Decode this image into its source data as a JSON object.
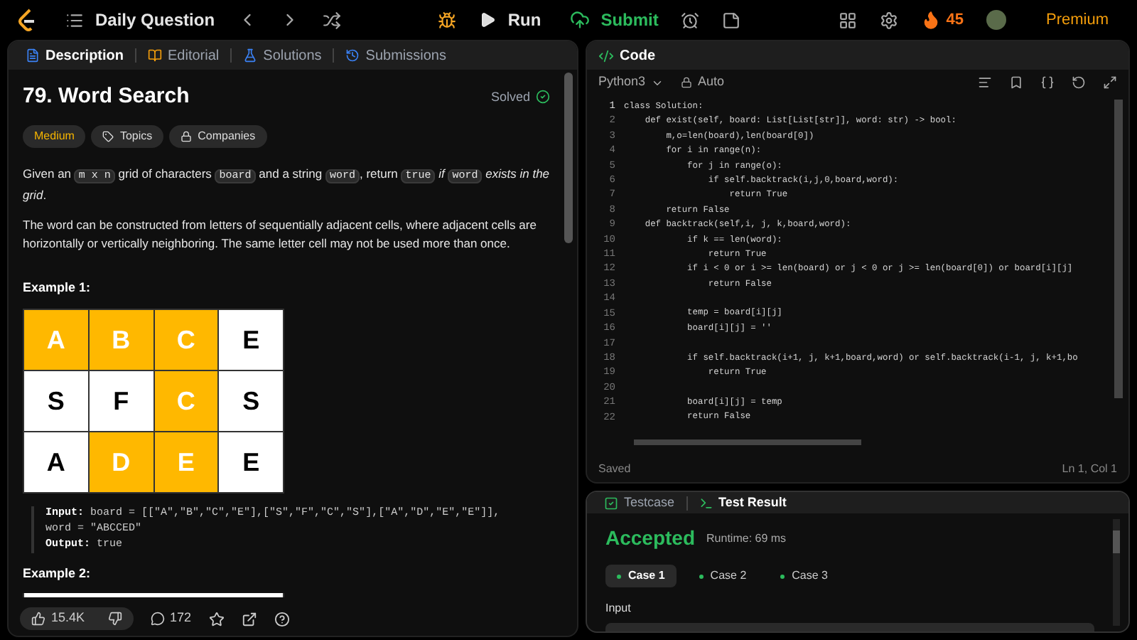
{
  "top_bar": {
    "title": "Daily Question",
    "run": "Run",
    "submit": "Submit",
    "streak": "45",
    "premium": "Premium"
  },
  "left_tabs": [
    {
      "label": "Description",
      "kind": "description",
      "selected": true
    },
    {
      "label": "Editorial",
      "kind": "editorial",
      "selected": false
    },
    {
      "label": "Solutions",
      "kind": "solutions",
      "selected": false
    },
    {
      "label": "Submissions",
      "kind": "submissions",
      "selected": false
    }
  ],
  "problem": {
    "title": "79. Word Search",
    "status": "Solved",
    "tags": [
      {
        "label": "Medium",
        "kind": "difficulty"
      },
      {
        "label": "Topics",
        "kind": "topics"
      },
      {
        "label": "Companies",
        "kind": "companies"
      }
    ],
    "paragraphs": [
      [
        {
          "kind": "text",
          "text": "Given an "
        },
        {
          "kind": "code",
          "text": "m x n"
        },
        {
          "kind": "text",
          "text": " grid of characters "
        },
        {
          "kind": "code",
          "text": "board"
        },
        {
          "kind": "text",
          "text": " and a string "
        },
        {
          "kind": "code",
          "text": "word"
        },
        {
          "kind": "text",
          "text": ", return "
        },
        {
          "kind": "code",
          "text": "true"
        },
        {
          "kind": "italic",
          "text": " if "
        },
        {
          "kind": "code",
          "text": "word"
        },
        {
          "kind": "italic",
          "text": " exists in the grid"
        },
        {
          "kind": "text",
          "text": "."
        }
      ],
      [
        {
          "kind": "text",
          "text": "The word can be constructed from letters of sequentially adjacent cells, where adjacent cells are horizontally or vertically neighboring. The same letter cell may not be used more than once."
        }
      ]
    ],
    "example_1": {
      "title": "Example 1:",
      "grid": [
        [
          {
            "letter": "A",
            "highlighted": true
          },
          {
            "letter": "B",
            "highlighted": true
          },
          {
            "letter": "C",
            "highlighted": true
          },
          {
            "letter": "E",
            "highlighted": false
          }
        ],
        [
          {
            "letter": "S",
            "highlighted": false
          },
          {
            "letter": "F",
            "highlighted": false
          },
          {
            "letter": "C",
            "highlighted": true
          },
          {
            "letter": "S",
            "highlighted": false
          }
        ],
        [
          {
            "letter": "A",
            "highlighted": false
          },
          {
            "letter": "D",
            "highlighted": true
          },
          {
            "letter": "E",
            "highlighted": true
          },
          {
            "letter": "E",
            "highlighted": false
          }
        ]
      ],
      "input_label": "Input:",
      "input": "board = [[\"A\",\"B\",\"C\",\"E\"],[\"S\",\"F\",\"C\",\"S\"],[\"A\",\"D\",\"E\",\"E\"]],",
      "input_cont": "word = \"ABCCED\"",
      "output_label": "Output:",
      "output": "true"
    },
    "example_2": {
      "title": "Example 2:"
    },
    "footer": {
      "likes": "15.4K",
      "comments": "172"
    }
  },
  "code_panel": {
    "title": "Code",
    "language": "Python3",
    "mode": "Auto",
    "status": "Saved",
    "cursor": "Ln 1, Col 1",
    "lines": [
      {
        "number": "1",
        "code": "class Solution:"
      },
      {
        "number": "2",
        "code": "    def exist(self, board: List[List[str]], word: str) -> bool:"
      },
      {
        "number": "3",
        "code": "        m,o=len(board),len(board[0])"
      },
      {
        "number": "4",
        "code": "        for i in range(n):"
      },
      {
        "number": "5",
        "code": "            for j in range(o):"
      },
      {
        "number": "6",
        "code": "                if self.backtrack(i,j,0,board,word):"
      },
      {
        "number": "7",
        "code": "                    return True"
      },
      {
        "number": "8",
        "code": "        return False"
      },
      {
        "number": "9",
        "code": "    def backtrack(self,i, j, k,board,word):"
      },
      {
        "number": "10",
        "code": "            if k == len(word):"
      },
      {
        "number": "11",
        "code": "                return True"
      },
      {
        "number": "12",
        "code": "            if i < 0 or i >= len(board) or j < 0 or j >= len(board[0]) or board[i][j]"
      },
      {
        "number": "13",
        "code": "                return False"
      },
      {
        "number": "14"
      },
      {
        "number": "15",
        "code": "            temp = board[i][j]"
      },
      {
        "number": "16",
        "code": "            board[i][j] = ''"
      },
      {
        "number": "17"
      },
      {
        "number": "18",
        "code": "            if self.backtrack(i+1, j, k+1,board,word) or self.backtrack(i-1, j, k+1,bo"
      },
      {
        "number": "19",
        "code": "                return True"
      },
      {
        "number": "20"
      },
      {
        "number": "21",
        "code": "            board[i][j] = temp"
      },
      {
        "number": "22",
        "code": "            return False"
      }
    ]
  },
  "test_panel": {
    "tabs": [
      {
        "label": "Testcase",
        "kind": "testcase",
        "selected": false
      },
      {
        "label": "Test Result",
        "kind": "result",
        "selected": true
      }
    ],
    "verdict": "Accepted",
    "runtime": "Runtime: 69 ms",
    "cases": [
      {
        "label": "Case 1",
        "passed": true,
        "selected": true
      },
      {
        "label": "Case 2",
        "passed": true,
        "selected": false
      },
      {
        "label": "Case 3",
        "passed": true,
        "selected": false
      }
    ],
    "input_label": "Input"
  }
}
